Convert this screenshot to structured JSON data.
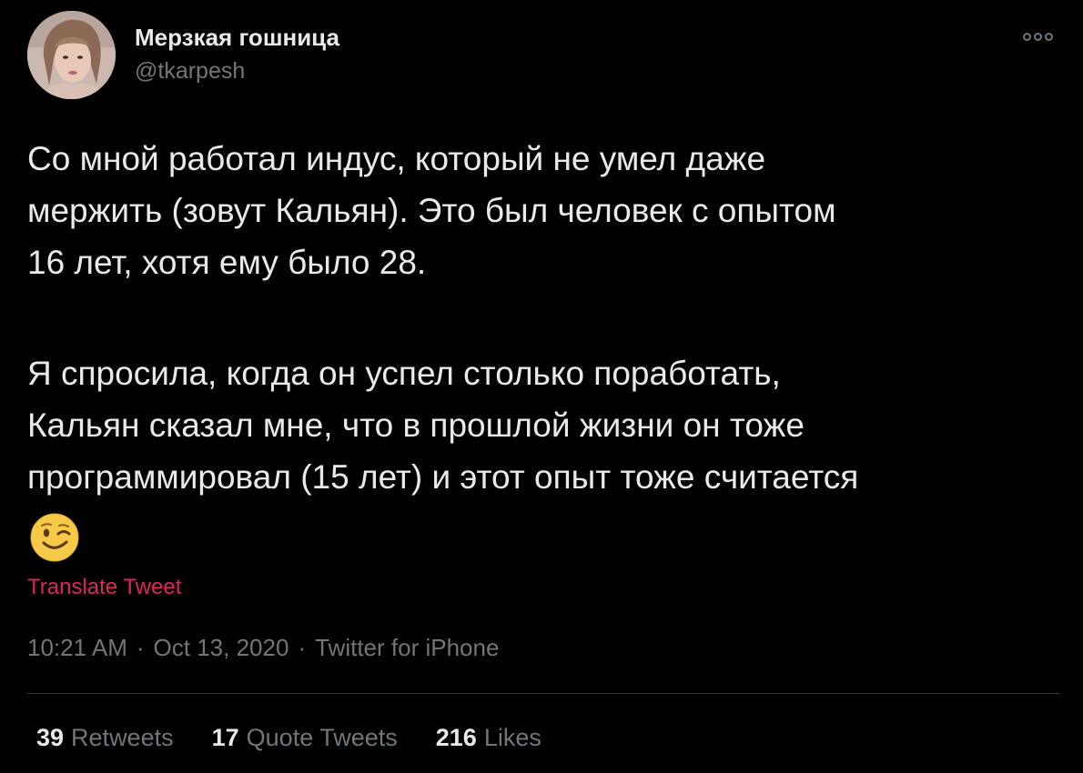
{
  "author": {
    "name": "Мерзкая гошница",
    "handle": "@tkarpesh",
    "avatar": "user-avatar-photo"
  },
  "more_icon": "more-options-icon",
  "tweet": {
    "lines": [
      "Со мной работал индус, который не умел даже",
      "мержить (зовут Кальян).  Это был человек с опытом",
      "16 лет, хотя ему было 28.",
      "Я спросила, когда он успел столько поработать,",
      "Кальян сказал мне, что в прошлой жизни он тоже",
      "программировал (15 лет) и этот опыт тоже считается"
    ],
    "emoji": "winking-face-emoji"
  },
  "translate_label": "Translate Tweet",
  "meta": {
    "time": "10:21 AM",
    "separator": "·",
    "date": "Oct 13, 2020",
    "source": "Twitter for iPhone"
  },
  "stats": {
    "retweets": {
      "count": "39",
      "label": "Retweets"
    },
    "quotes": {
      "count": "17",
      "label": "Quote Tweets"
    },
    "likes": {
      "count": "216",
      "label": "Likes"
    }
  },
  "colors": {
    "background": "#000000",
    "text": "#e7e9ea",
    "secondary": "#71767b",
    "translate": "#e0245e",
    "divider": "#2f3336"
  }
}
